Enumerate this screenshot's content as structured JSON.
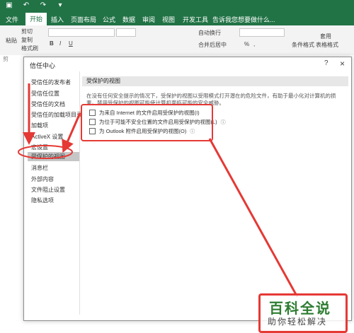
{
  "quick_access": [
    "save-icon",
    "undo-icon",
    "redo-icon",
    "customize-icon"
  ],
  "tabs": [
    "文件",
    "开始",
    "插入",
    "页面布局",
    "公式",
    "数据",
    "审阅",
    "视图",
    "开发工具"
  ],
  "active_tab": "开始",
  "tell_me": "告诉我您想要做什么...",
  "ribbon": {
    "paste": "粘贴",
    "cut": "剪切",
    "copy": "复制",
    "format_painter": "格式刷",
    "bold": "B",
    "italic": "I",
    "underline": "U",
    "wrap_text": "自动换行",
    "merge_center": "合并后居中",
    "percent": "%",
    "comma": ",",
    "conditional_format": "条件格式",
    "table_format_1": "套用",
    "table_format_2": "表格格式",
    "clipboard_label": "剪"
  },
  "dialog": {
    "title": "信任中心",
    "help": "?",
    "close": "×",
    "nav_items": [
      "受信任的发布者",
      "受信任位置",
      "受信任的文档",
      "受信任的加载项目录",
      "加载项",
      "ActiveX 设置",
      "宏设置",
      "受保护的视图",
      "消息栏",
      "外部内容",
      "文件阻止设置",
      "隐私选项"
    ],
    "selected_nav": "受保护的视图",
    "section_title": "受保护的视图",
    "description": "在没有任何安全提示的情况下，受保护的视图以受限模式打开潜在的危险文件，有助于最小化对计算机的损害。禁用受保护的视图可能使计算机面临可能的安全威胁。",
    "options": [
      {
        "label": "为来自 Internet 的文件启用受保护的视图(I)",
        "checked": false,
        "info": ""
      },
      {
        "label": "为位于可能不安全位置的文件启用受保护的视图(L)",
        "checked": false,
        "info": "ⓘ"
      },
      {
        "label": "为 Outlook 附件启用受保护的视图(O)",
        "checked": false,
        "info": "ⓘ"
      }
    ]
  },
  "watermark": {
    "main": "百科全说",
    "sub": "助你轻松解决"
  },
  "colors": {
    "excel_green": "#217346",
    "annotation_red": "#e53935",
    "watermark_green": "#2e7d32"
  }
}
